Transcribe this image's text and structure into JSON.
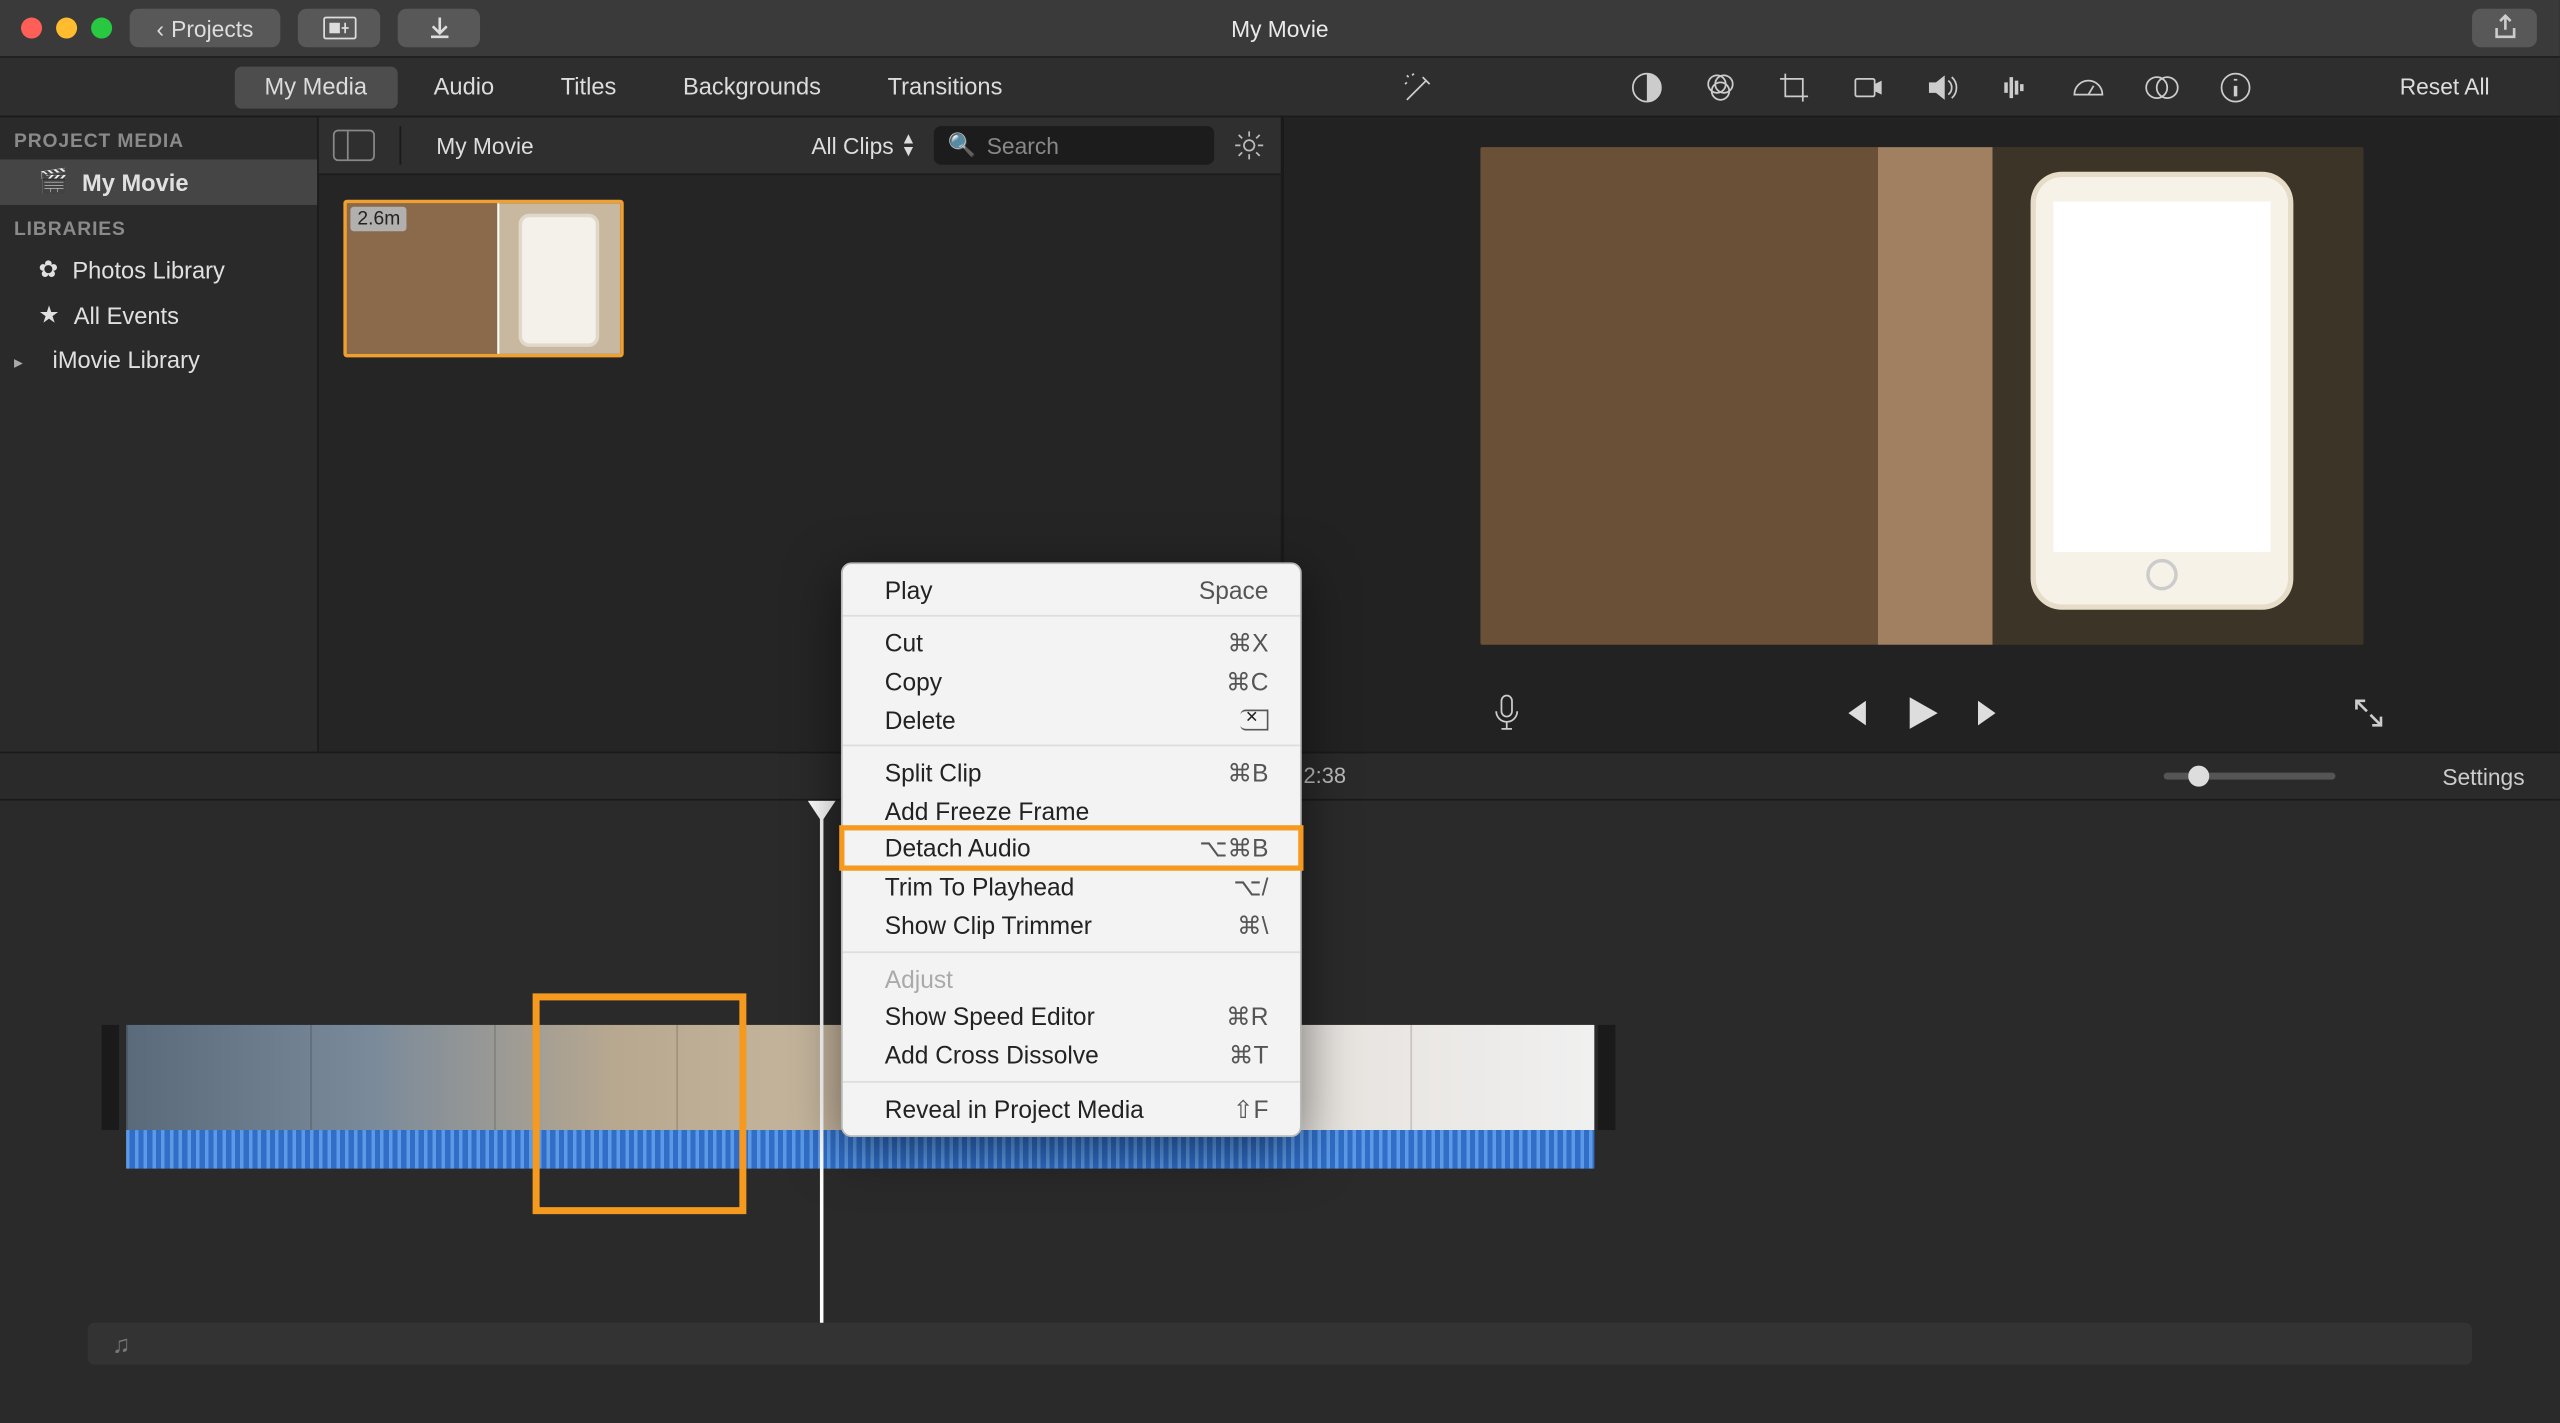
{
  "titlebar": {
    "projects": "Projects",
    "title": "My Movie"
  },
  "tabs": [
    "My Media",
    "Audio",
    "Titles",
    "Backgrounds",
    "Transitions"
  ],
  "active_tab": 0,
  "reset_all": "Reset All",
  "sidebar": {
    "proj_head": "PROJECT MEDIA",
    "proj_item": "My Movie",
    "lib_head": "LIBRARIES",
    "items": [
      "Photos Library",
      "All Events",
      "iMovie Library"
    ]
  },
  "browser": {
    "crumb": "My Movie",
    "allclips": "All Clips",
    "search_placeholder": "Search",
    "clip_duration": "2.6m"
  },
  "timeline": {
    "time": "2:38",
    "settings": "Settings",
    "bgm_glyph": "♫"
  },
  "context_menu": {
    "items": [
      {
        "label": "Play",
        "shortcut": "Space"
      },
      {
        "sep": true
      },
      {
        "label": "Cut",
        "shortcut": "⌘X"
      },
      {
        "label": "Copy",
        "shortcut": "⌘C"
      },
      {
        "label": "Delete",
        "shortcut": "",
        "del_icon": true
      },
      {
        "sep": true
      },
      {
        "label": "Split Clip",
        "shortcut": "⌘B"
      },
      {
        "label": "Add Freeze Frame"
      },
      {
        "label": "Detach Audio",
        "shortcut": "⌥⌘B",
        "highlight": true
      },
      {
        "label": "Trim To Playhead",
        "shortcut": "⌥/"
      },
      {
        "label": "Show Clip Trimmer",
        "shortcut": "⌘\\"
      },
      {
        "sep": true
      },
      {
        "label": "Adjust",
        "disabled": true
      },
      {
        "label": "Show Speed Editor",
        "shortcut": "⌘R"
      },
      {
        "label": "Add Cross Dissolve",
        "shortcut": "⌘T"
      },
      {
        "sep": true
      },
      {
        "label": "Reveal in Project Media",
        "shortcut": "⇧F"
      }
    ]
  },
  "adjust_tools": [
    "wand",
    "balance",
    "color-wheel",
    "crop",
    "camera",
    "volume",
    "eq",
    "speed",
    "filter",
    "info"
  ]
}
